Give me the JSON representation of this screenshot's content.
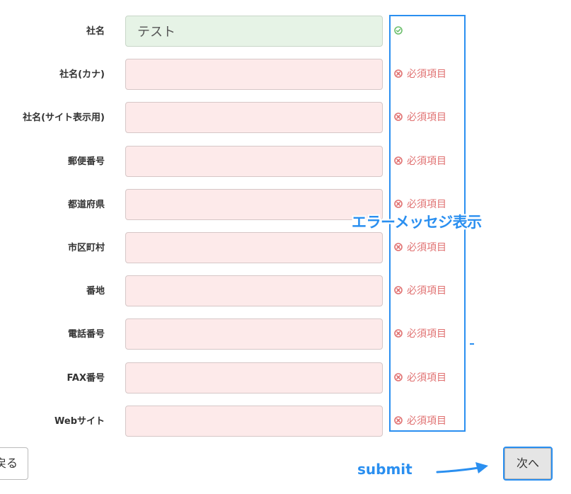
{
  "form": {
    "rows": [
      {
        "label": "社名",
        "value": "テスト",
        "status": "valid",
        "message": ""
      },
      {
        "label": "社名(カナ)",
        "value": "",
        "status": "error",
        "message": "必須項目"
      },
      {
        "label": "社名(サイト表示用)",
        "value": "",
        "status": "error",
        "message": "必須項目"
      },
      {
        "label": "郵便番号",
        "value": "",
        "status": "error",
        "message": "必須項目"
      },
      {
        "label": "都道府県",
        "value": "",
        "status": "error",
        "message": "必須項目"
      },
      {
        "label": "市区町村",
        "value": "",
        "status": "error",
        "message": "必須項目"
      },
      {
        "label": "番地",
        "value": "",
        "status": "error",
        "message": "必須項目"
      },
      {
        "label": "電話番号",
        "value": "",
        "status": "error",
        "message": "必須項目"
      },
      {
        "label": "FAX番号",
        "value": "",
        "status": "error",
        "message": "必須項目"
      },
      {
        "label": "Webサイト",
        "value": "",
        "status": "error",
        "message": "必須項目"
      }
    ]
  },
  "buttons": {
    "back_label": "戻る",
    "next_label": "次へ"
  },
  "annotations": {
    "error_display": "エラーメッセジ表示",
    "submit": "submit"
  },
  "colors": {
    "error_text": "#e07070",
    "error_field_bg": "#fdeaea",
    "valid_field_bg": "#e6f3e6",
    "valid_icon": "#6cbf6c",
    "annotation_blue": "#2a8ff0"
  },
  "icons": {
    "valid": "check-circle-icon",
    "error": "x-circle-icon"
  }
}
